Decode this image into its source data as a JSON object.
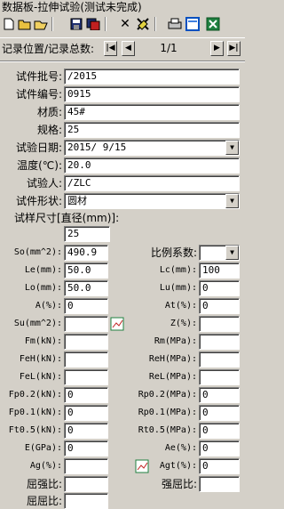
{
  "window": {
    "title": "数据板-拉伸试验(测试未完成)"
  },
  "toolbar": {
    "icons": [
      "new-icon",
      "open-icon",
      "save-icon",
      "save-all-icon",
      "delete-icon",
      "clear-icon",
      "print-icon",
      "preview-icon",
      "excel-icon"
    ]
  },
  "nav": {
    "label": "记录位置/记录总数:",
    "first": "|◀",
    "prev": "◀",
    "count": "1/1",
    "next": "▶",
    "last": "▶|"
  },
  "fields": {
    "batch": {
      "label": "试件批号:",
      "value": "/2015"
    },
    "number": {
      "label": "试件编号:",
      "value": "0915"
    },
    "material": {
      "label": "材质:",
      "value": "45#"
    },
    "spec": {
      "label": "规格:",
      "value": "25"
    },
    "date": {
      "label": "试验日期:",
      "value": "2015/ 9/15"
    },
    "temp": {
      "label": "温度(℃):",
      "value": "20.0"
    },
    "tester": {
      "label": "试验人:",
      "value": "/ZLC"
    },
    "shape": {
      "label": "试件形状:",
      "value": "圆材"
    },
    "size": {
      "label": "试样尺寸[直径(mm)]:",
      "value": "25"
    }
  },
  "params": {
    "so": {
      "label": "So(mm^2):",
      "value": "490.9"
    },
    "ratio": {
      "label": "比例系数:",
      "value": ""
    },
    "le": {
      "label": "Le(mm):",
      "value": "50.0"
    },
    "lc": {
      "label": "Lc(mm):",
      "value": "100"
    },
    "lo": {
      "label": "Lo(mm):",
      "value": "50.0"
    },
    "lu": {
      "label": "Lu(mm):",
      "value": "0"
    },
    "a": {
      "label": "A(%):",
      "value": "0"
    },
    "at": {
      "label": "At(%):",
      "value": "0"
    },
    "su": {
      "label": "Su(mm^2):",
      "value": ""
    },
    "z": {
      "label": "Z(%):",
      "value": ""
    },
    "fm": {
      "label": "Fm(kN):",
      "value": ""
    },
    "rm": {
      "label": "Rm(MPa):",
      "value": ""
    },
    "feh": {
      "label": "FeH(kN):",
      "value": ""
    },
    "reh": {
      "label": "ReH(MPa):",
      "value": ""
    },
    "fel": {
      "label": "FeL(kN):",
      "value": ""
    },
    "rel": {
      "label": "ReL(MPa):",
      "value": ""
    },
    "fp02": {
      "label": "Fp0.2(kN):",
      "value": "0"
    },
    "rp02": {
      "label": "Rp0.2(MPa):",
      "value": "0"
    },
    "fp01": {
      "label": "Fp0.1(kN):",
      "value": "0"
    },
    "rp01": {
      "label": "Rp0.1(MPa):",
      "value": "0"
    },
    "ft05": {
      "label": "Ft0.5(kN):",
      "value": "0"
    },
    "rt05": {
      "label": "Rt0.5(MPa):",
      "value": "0"
    },
    "e": {
      "label": "E(GPa):",
      "value": "0"
    },
    "ae": {
      "label": "Ae(%):",
      "value": "0"
    },
    "ag": {
      "label": "Ag(%):",
      "value": ""
    },
    "agt": {
      "label": "Agt(%):",
      "value": "0"
    },
    "yield_ratio": {
      "label": "屈强比:",
      "value": ""
    },
    "strong_yield": {
      "label": "强屈比:",
      "value": ""
    },
    "yield_yield": {
      "label": "屈屈比:",
      "value": ""
    }
  }
}
